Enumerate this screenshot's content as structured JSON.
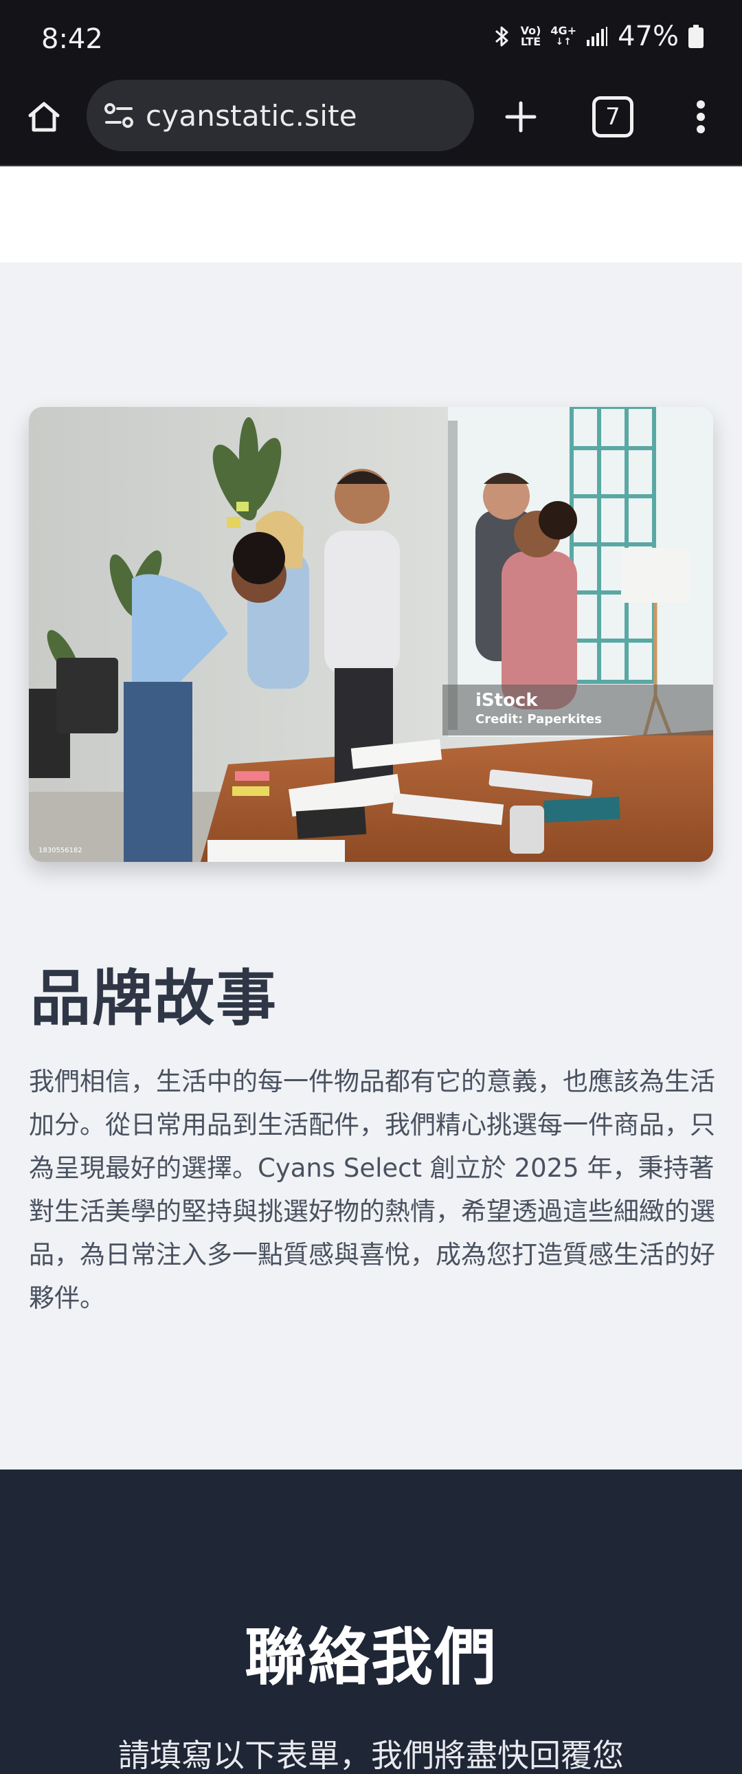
{
  "status_bar": {
    "time": "8:42",
    "network_vol_lte_top": "Vo)",
    "network_vol_lte_bottom": "LTE",
    "network_4g": "4G+",
    "battery_percent": "47%",
    "battery_level": 0.47,
    "icons": [
      "bluetooth-icon",
      "signal-icon",
      "battery-icon"
    ]
  },
  "browser": {
    "url": "cyanstatic.site",
    "tab_count": "7",
    "icons": [
      "home-icon",
      "site-settings-icon",
      "new-tab-icon",
      "tabs-icon",
      "more-menu-icon"
    ]
  },
  "story": {
    "photo": {
      "watermark_brand": "iStock",
      "watermark_credit": "Credit: Paperkites",
      "stock_id": "1830556182"
    },
    "title": "品牌故事",
    "paragraph": "我們相信，生活中的每一件物品都有它的意義，也應該為生活加分。從日常用品到生活配件，我們精心挑選每一件商品，只為呈現最好的選擇。Cyans Select 創立於 2025 年，秉持著對生活美學的堅持與挑選好物的熱情，希望透過這些細緻的選品，為日常注入多一點質感與喜悅，成為您打造質感生活的好夥伴。"
  },
  "contact": {
    "title": "聯絡我們",
    "subtitle": "請填寫以下表單，我們將盡快回覆您"
  },
  "colors": {
    "browser_bg": "#131318",
    "page_bg": "#f0f2f5",
    "heading": "#2f3747",
    "body_text": "#4a5160",
    "contact_bg": "#1f2635"
  }
}
